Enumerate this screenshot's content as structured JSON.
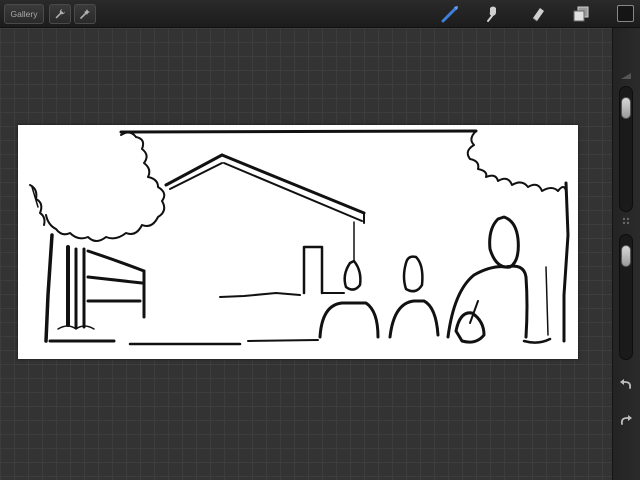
{
  "toolbar": {
    "gallery_label": "Gallery",
    "left_tools": [
      "wrench-icon",
      "magic-wand-icon"
    ],
    "right_tools": [
      "brush-icon",
      "smudge-icon",
      "eraser-icon",
      "layers-icon"
    ],
    "active_tool": "brush-icon"
  },
  "side_panel": {
    "brush_size_level": 0.1,
    "brush_opacity_level": 0.1,
    "current_color": "#151515",
    "buttons": [
      "undo-icon",
      "redo-icon"
    ]
  },
  "colors": {
    "accent": "#3d7fd9",
    "canvas": "#ffffff",
    "ink": "#111111",
    "workspace": "#333333"
  }
}
